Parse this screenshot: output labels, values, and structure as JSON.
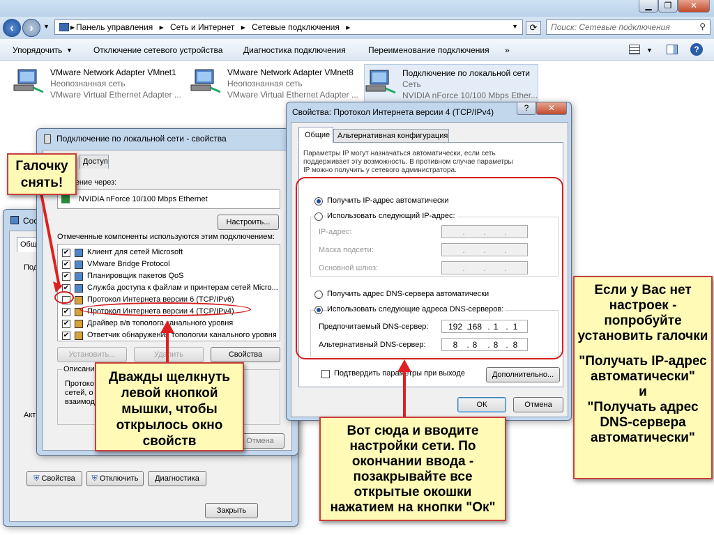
{
  "explorer": {
    "breadcrumb": [
      "Панель управления",
      "Сеть и Интернет",
      "Сетевые подключения"
    ],
    "search_placeholder": "Поиск: Сетевые подключения",
    "commands": [
      "Упорядочить",
      "Отключение сетевого устройства",
      "Диагностика подключения",
      "Переименование подключения",
      "»"
    ],
    "adapters": [
      {
        "name": "VMware Network Adapter VMnet1",
        "status": "Неопознанная сеть",
        "device": "VMware Virtual Ethernet Adapter ..."
      },
      {
        "name": "VMware Network Adapter VMnet8",
        "status": "Неопознанная сеть",
        "device": "VMware Virtual Ethernet Adapter ..."
      },
      {
        "name": "Подключение по локальной сети",
        "status": "Сеть",
        "device": "NVIDIA nForce 10/100 Mbps Ether..."
      }
    ]
  },
  "status_win": {
    "title_fragment": "Сос",
    "tab_fragment": "Общи",
    "frag_pod": "Под",
    "frag_akt": "Акти",
    "buttons": {
      "properties": "Свойства",
      "disable": "Отключить",
      "diagnostics": "Диагностика",
      "close": "Закрыть"
    }
  },
  "props_win": {
    "title": "Подключение по локальной сети - свойства",
    "tab_access": "Доступ",
    "connect_via_label": "ючение через:",
    "adapter": "NVIDIA nForce 10/100 Mbps Ethernet",
    "configure": "Настроить...",
    "components_label": "Отмеченные компоненты используются этим подключением:",
    "components": [
      {
        "label": "Клиент для сетей Microsoft",
        "checked": true
      },
      {
        "label": "VMware Bridge Protocol",
        "checked": true
      },
      {
        "label": "Планировщик пакетов QoS",
        "checked": true
      },
      {
        "label": "Служба доступа к файлам и принтерам сетей Micro...",
        "checked": true
      },
      {
        "label": "Протокол Интернета версии 6 (TCP/IPv6)",
        "checked": false
      },
      {
        "label": "Протокол Интернета версии 4 (TCP/IPv4)",
        "checked": true
      },
      {
        "label": "Драйвер в/в тополога канального уровня",
        "checked": true
      },
      {
        "label": "Ответчик обнаружения топологии канального уровня",
        "checked": true
      }
    ],
    "install": "Установить...",
    "remove": "Удалить",
    "properties": "Свойства",
    "desc_label": "Описани",
    "desc_text": [
      "Протоко",
      "сетей, о",
      "взаимод"
    ],
    "cancel": "Отмена"
  },
  "ipv4_win": {
    "title": "Свойства: Протокол Интернета версии 4 (TCP/IPv4)",
    "help": "?",
    "close": "✕",
    "tab_general": "Общие",
    "tab_alt": "Альтернативная конфигурация",
    "intro": [
      "Параметры IP могут назначаться автоматически, если сеть",
      "поддерживает эту возможность. В противном случае параметры",
      "IP можно получить у сетевого администратора."
    ],
    "ip_auto": "Получить IP-адрес автоматически",
    "ip_manual": "Использовать следующий IP-адрес:",
    "ip_address": "IP-адрес:",
    "subnet": "Маска подсети:",
    "gateway": "Основной шлюз:",
    "dns_auto": "Получить адрес DNS-сервера автоматически",
    "dns_manual": "Использовать следующие адреса DNS-серверов:",
    "dns_pref_label": "Предпочитаемый DNS-сервер:",
    "dns_alt_label": "Альтернативный DNS-сервер:",
    "dns_pref": [
      "192",
      "168",
      "1",
      "1"
    ],
    "dns_alt": [
      "8",
      "8",
      "8",
      "8"
    ],
    "validate": "Подтвердить параметры при выходе",
    "advanced": "Дополнительно...",
    "ok": "ОК",
    "cancel": "Отмена",
    "ip_auto_selected": true,
    "dns_manual_selected": true
  },
  "notes": {
    "checkbox": "Галочку снять!",
    "doubleclick": "Дважды щелкнуть левой кнопкой мышки, чтобы открылось окно свойств",
    "enter": "Вот сюда и вводите настройки сети. По окончании ввода - позакрывайте все открытые окошки нажатием на кнопки \"Ок\"",
    "right": [
      "Если у Вас нет настроек - попробуйте установить галочки",
      "\"Получать IP-адрес автоматически\"",
      "и",
      "\"Получать адрес DNS-сервера автоматически\""
    ]
  },
  "colors": {
    "note_bg": "#fffbb6",
    "note_border": "#c8403a",
    "highlight": "#d42020"
  }
}
